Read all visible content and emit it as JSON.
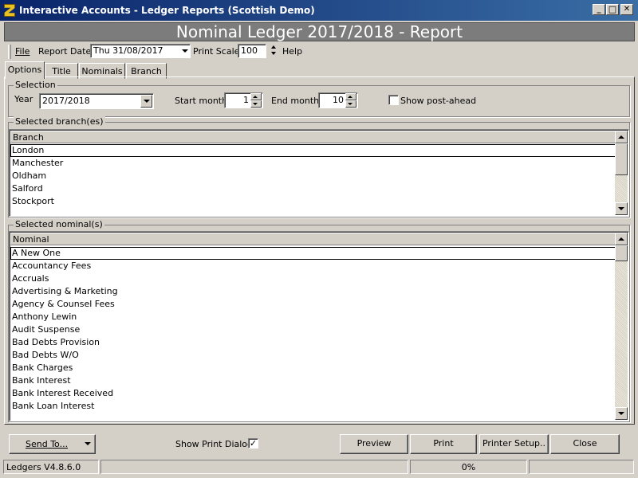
{
  "window": {
    "title": "Interactive Accounts - Ledger Reports (Scottish Demo)",
    "controls": {
      "minimize": "_",
      "maximize": "□",
      "close": "✕"
    }
  },
  "banner": {
    "title": "Nominal Ledger 2017/2018 - Report"
  },
  "toolbar": {
    "file": "File",
    "report_date_label": "Report Date",
    "report_date_value": "Thu 31/08/2017",
    "print_scale_label": "Print Scale",
    "print_scale_value": "100",
    "help": "Help"
  },
  "tabs": [
    "Options",
    "Title",
    "Nominals",
    "Branch"
  ],
  "selection": {
    "group_label": "Selection",
    "year_label": "Year",
    "year_value": "2017/2018",
    "start_month_label": "Start month",
    "start_month_value": "1",
    "end_month_label": "End month",
    "end_month_value": "10",
    "post_ahead_label": "Show post-ahead",
    "post_ahead_checked": false
  },
  "branches": {
    "group_label": "Selected branch(es)",
    "column": "Branch",
    "items": [
      "London",
      "Manchester",
      "Oldham",
      "Salford",
      "Stockport"
    ]
  },
  "nominals": {
    "group_label": "Selected nominal(s)",
    "column": "Nominal",
    "items": [
      "A New One",
      "Accountancy Fees",
      "Accruals",
      "Advertising & Marketing",
      "Agency & Counsel Fees",
      "Anthony Lewin",
      "Audit Suspense",
      "Bad Debts Provision",
      "Bad Debts W/O",
      "Bank Charges",
      "Bank Interest",
      "Bank Interest Received",
      "Bank Loan Interest"
    ]
  },
  "footer": {
    "send_to": "Send To...",
    "show_print_dialog": "Show Print Dialog",
    "show_print_dialog_checked": true,
    "preview": "Preview",
    "print": "Print",
    "printer_setup": "Printer Setup..",
    "close": "Close"
  },
  "status": {
    "version": "Ledgers V4.8.6.0",
    "progress": "0%"
  }
}
